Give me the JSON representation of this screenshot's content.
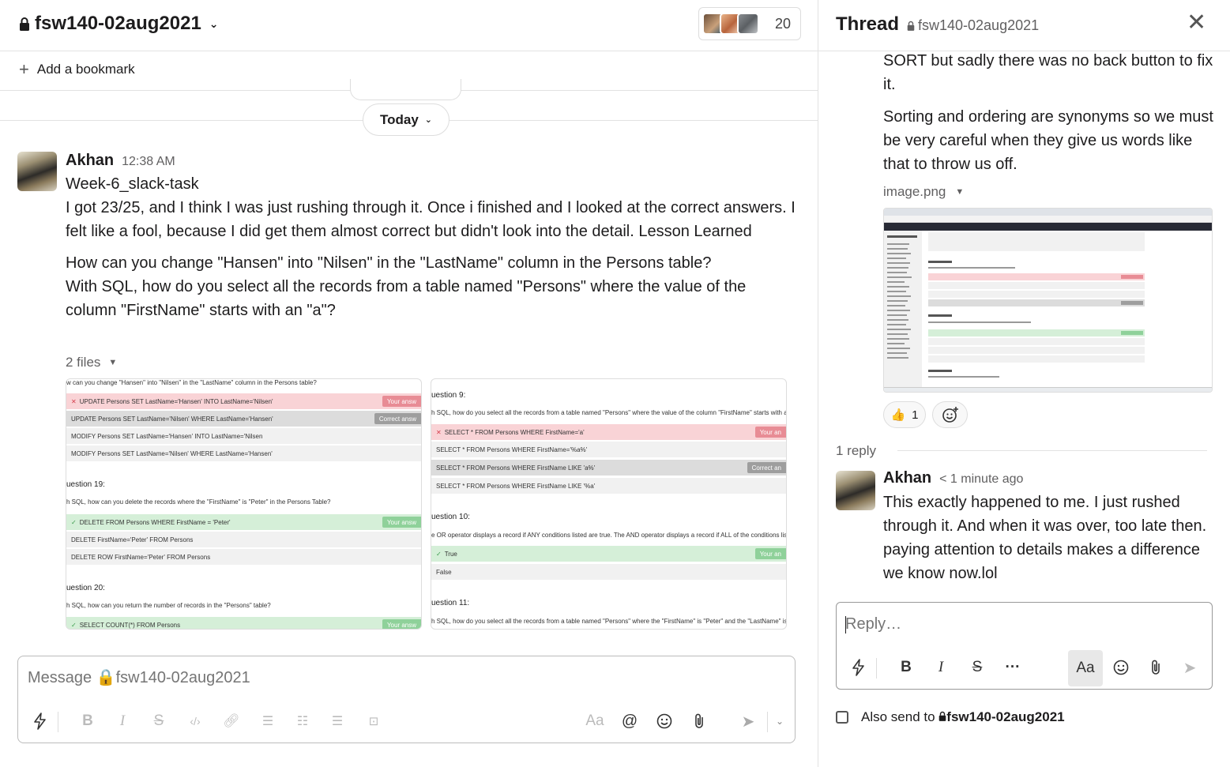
{
  "channel": {
    "name": "fsw140-02aug2021",
    "member_count": "20",
    "bookmark_label": "Add a bookmark",
    "day_divider": "Today"
  },
  "message": {
    "author": "Akhan",
    "time": "12:38 AM",
    "line1": "Week-6_slack-task",
    "para1": "I got 23/25, and I think I was just rushing through it. Once i finished and I looked at the correct answers. I felt like a fool, because I did get them almost correct but didn't look into the detail. Lesson Learned",
    "para2a": "How can you change \"Hansen\" into \"Nilsen\" in the \"LastName\" column in the Persons table?",
    "para2b": "With SQL, how do you select all the records from a table named \"Persons\" where the value of the column \"FirstName\" starts with an \"a\"?",
    "files_label": "2 files"
  },
  "shot_left": {
    "q_top": "w can you change \"Hansen\" into \"Nilsen\" in the \"LastName\" column in the Persons table?",
    "opts1": [
      {
        "text": "UPDATE Persons SET LastName='Hansen' INTO LastName='Nilsen'",
        "mark": "✕",
        "tag": "Your answ"
      },
      {
        "text": "UPDATE Persons SET LastName='Nilsen' WHERE LastName='Hansen'",
        "mark": "",
        "tag": "Correct answ"
      },
      {
        "text": "MODIFY Persons SET LastName='Hansen' INTO LastName='Nilsen",
        "mark": "",
        "tag": ""
      },
      {
        "text": "MODIFY Persons SET LastName='Nilsen' WHERE LastName='Hansen'",
        "mark": "",
        "tag": ""
      }
    ],
    "q19": "uestion 19:",
    "q19_text": "h SQL, how can you delete the records where the \"FirstName\" is \"Peter\" in the Persons Table?",
    "opts2": [
      {
        "text": "DELETE FROM Persons WHERE FirstName = 'Peter'",
        "mark": "✓",
        "tag": "Your answ"
      },
      {
        "text": "DELETE FirstName='Peter' FROM Persons",
        "mark": "",
        "tag": ""
      },
      {
        "text": "DELETE ROW FirstName='Peter' FROM Persons",
        "mark": "",
        "tag": ""
      }
    ],
    "q20": "uestion 20:",
    "q20_text": "h SQL, how can you return the number of records in the \"Persons\" table?",
    "opt3": {
      "text": "SELECT COUNT(*) FROM Persons",
      "mark": "✓",
      "tag": "Your answ"
    }
  },
  "shot_right": {
    "q9": "uestion 9:",
    "q9_text": "h SQL, how do you select all the records from a table named \"Persons\" where the value of the column \"FirstName\" starts with an \"a\"?",
    "opts1": [
      {
        "text": "SELECT * FROM Persons WHERE FirstName='a'",
        "mark": "✕",
        "tag": "Your an"
      },
      {
        "text": "SELECT * FROM Persons WHERE FirstName='%a%'",
        "mark": "",
        "tag": ""
      },
      {
        "text": "SELECT * FROM Persons WHERE FirstName LIKE 'a%'",
        "mark": "",
        "tag": "Correct an"
      },
      {
        "text": "SELECT * FROM Persons WHERE FirstName LIKE '%a'",
        "mark": "",
        "tag": ""
      }
    ],
    "q10": "uestion 10:",
    "q10_text": "e OR operator displays a record if ANY conditions listed are true. The AND operator displays a record if ALL of the conditions listed are true",
    "opts2": [
      {
        "text": "True",
        "mark": "✓",
        "tag": "Your an"
      },
      {
        "text": "False",
        "mark": "",
        "tag": ""
      }
    ],
    "q11": "uestion 11:",
    "q11_text": "h SQL, how do you select all the records from a table named \"Persons\" where the \"FirstName\" is \"Peter\" and the \"LastName\" is \"Jackson\"?"
  },
  "composer": {
    "placeholder": "Message 🔒fsw140-02aug2021",
    "aa": "Aa"
  },
  "thread": {
    "title": "Thread",
    "channel": "fsw140-02aug2021",
    "text1": "SORT but sadly there was no back button to fix it.",
    "text2": "Sorting and ordering are synonyms so we must be very careful when they give us words like that to throw us off.",
    "file_label": "image.png",
    "reaction_emoji": "👍",
    "reaction_count": "1",
    "reply_count": "1 reply",
    "reply_author": "Akhan",
    "reply_time": "< 1 minute ago",
    "reply_text": "This exactly happened to me. I just rushed through it. And when it was over, too late then. paying attention to details makes a difference we know now.lol",
    "reply_placeholder": "Reply…",
    "aa": "Aa",
    "also_send_label": "Also send to",
    "also_send_channel": "fsw140-02aug2021"
  },
  "icons": {
    "lock": "lock-icon",
    "close": "close-icon",
    "lightning": "shortcuts-icon",
    "bold": "bold-icon",
    "italic": "italic-icon",
    "strike": "strikethrough-icon",
    "code": "code-icon",
    "link": "link-icon",
    "ol": "ordered-list-icon",
    "ul": "bulleted-list-icon",
    "quote": "blockquote-icon",
    "codeblock": "code-block-icon",
    "mention": "mention-icon",
    "emoji": "emoji-icon",
    "attach": "attachment-icon",
    "send": "send-icon",
    "more": "more-icon",
    "add-reaction": "add-reaction-icon"
  },
  "colors": {
    "wrong_bg": "#f9d3d6",
    "correct_bg": "#d5efd8",
    "grey_bg": "#dcdcdc"
  }
}
